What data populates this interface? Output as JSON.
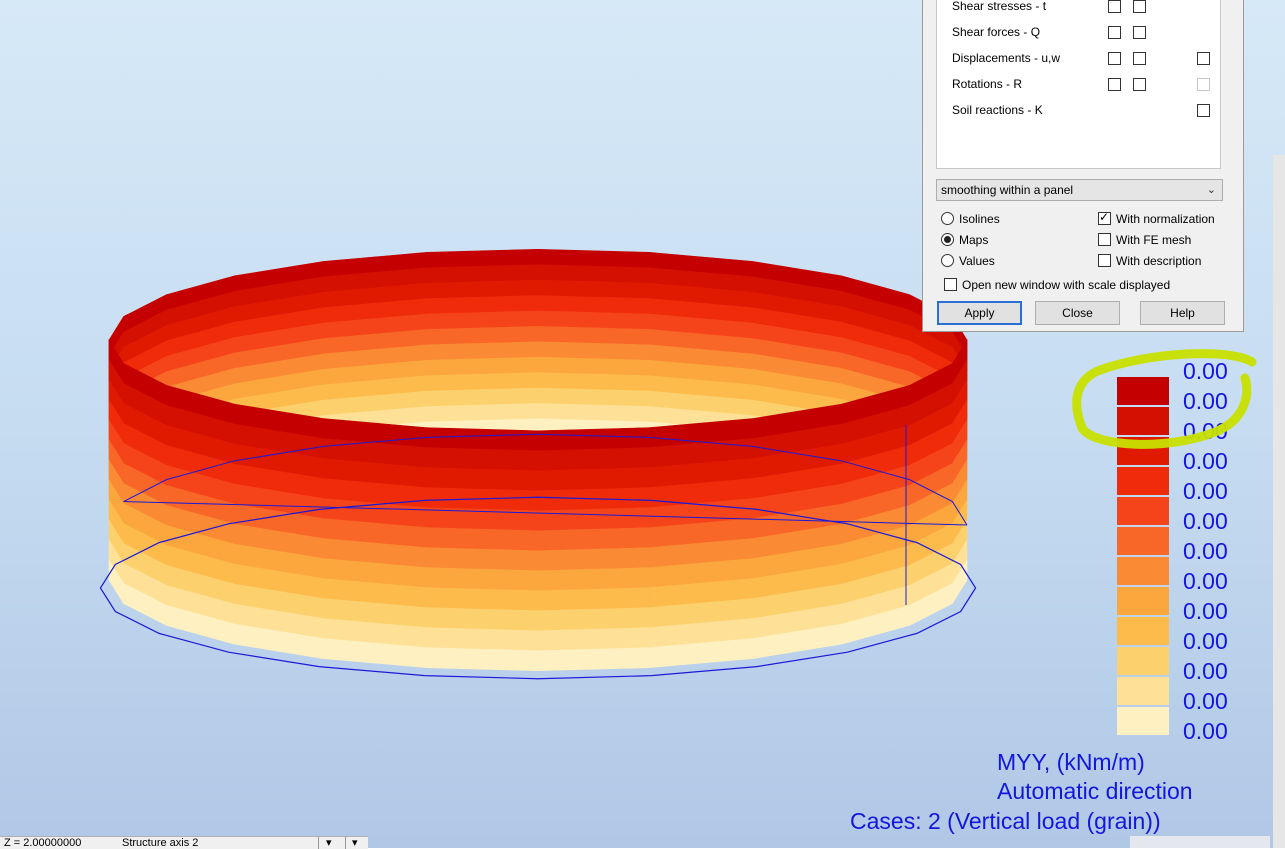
{
  "dialog": {
    "rows": [
      {
        "label": "Shear stresses - t",
        "boxes": [
          true,
          true,
          false
        ],
        "disabled": [
          false,
          false,
          false
        ]
      },
      {
        "label": "Shear forces - Q",
        "boxes": [
          true,
          true,
          false
        ],
        "disabled": [
          false,
          false,
          false
        ]
      },
      {
        "label": "Displacements - u,w",
        "boxes": [
          true,
          true,
          true
        ],
        "disabled": [
          false,
          false,
          false
        ]
      },
      {
        "label": "Rotations - R",
        "boxes": [
          true,
          true,
          true
        ],
        "disabled": [
          false,
          false,
          true
        ]
      },
      {
        "label": "Soil reactions - K",
        "boxes": [
          false,
          false,
          true
        ],
        "disabled": [
          false,
          false,
          false
        ]
      }
    ],
    "smoothing": "smoothing within a panel",
    "display_modes": [
      {
        "label": "Isolines",
        "selected": false
      },
      {
        "label": "Maps",
        "selected": true
      },
      {
        "label": "Values",
        "selected": false
      }
    ],
    "options": [
      {
        "label": "With normalization",
        "checked": true
      },
      {
        "label": "With FE mesh",
        "checked": false
      },
      {
        "label": "With description",
        "checked": false
      }
    ],
    "open_new_window": {
      "label": "Open new window with scale displayed",
      "checked": false
    },
    "apply_label": "Apply",
    "close_label": "Close",
    "help_label": "Help"
  },
  "legend": {
    "top_value": "0.00",
    "values": [
      "0.00",
      "0.00",
      "0.00",
      "0.00",
      "0.00",
      "0.00",
      "0.00",
      "0.00",
      "0.00",
      "0.00",
      "0.00",
      "0.00"
    ],
    "colors": [
      "#c40000",
      "#d41000",
      "#e01a00",
      "#ef2b0a",
      "#f5441a",
      "#f86628",
      "#fa8a34",
      "#fca63e",
      "#fdbb4c",
      "#fdd06e",
      "#fee196",
      "#fff0c2"
    ]
  },
  "captions": {
    "quantity": "MYY, (kNm/m)",
    "direction": "Automatic direction",
    "cases": "Cases: 2 (Vertical load (grain))"
  },
  "statusbar": {
    "coordinate": "Z = 2.00000000",
    "structure": "Structure axis 2"
  },
  "colors": {
    "caption_blue": "#1515e0",
    "highlight": "#c8e000",
    "outline": "#1a1ad8"
  }
}
